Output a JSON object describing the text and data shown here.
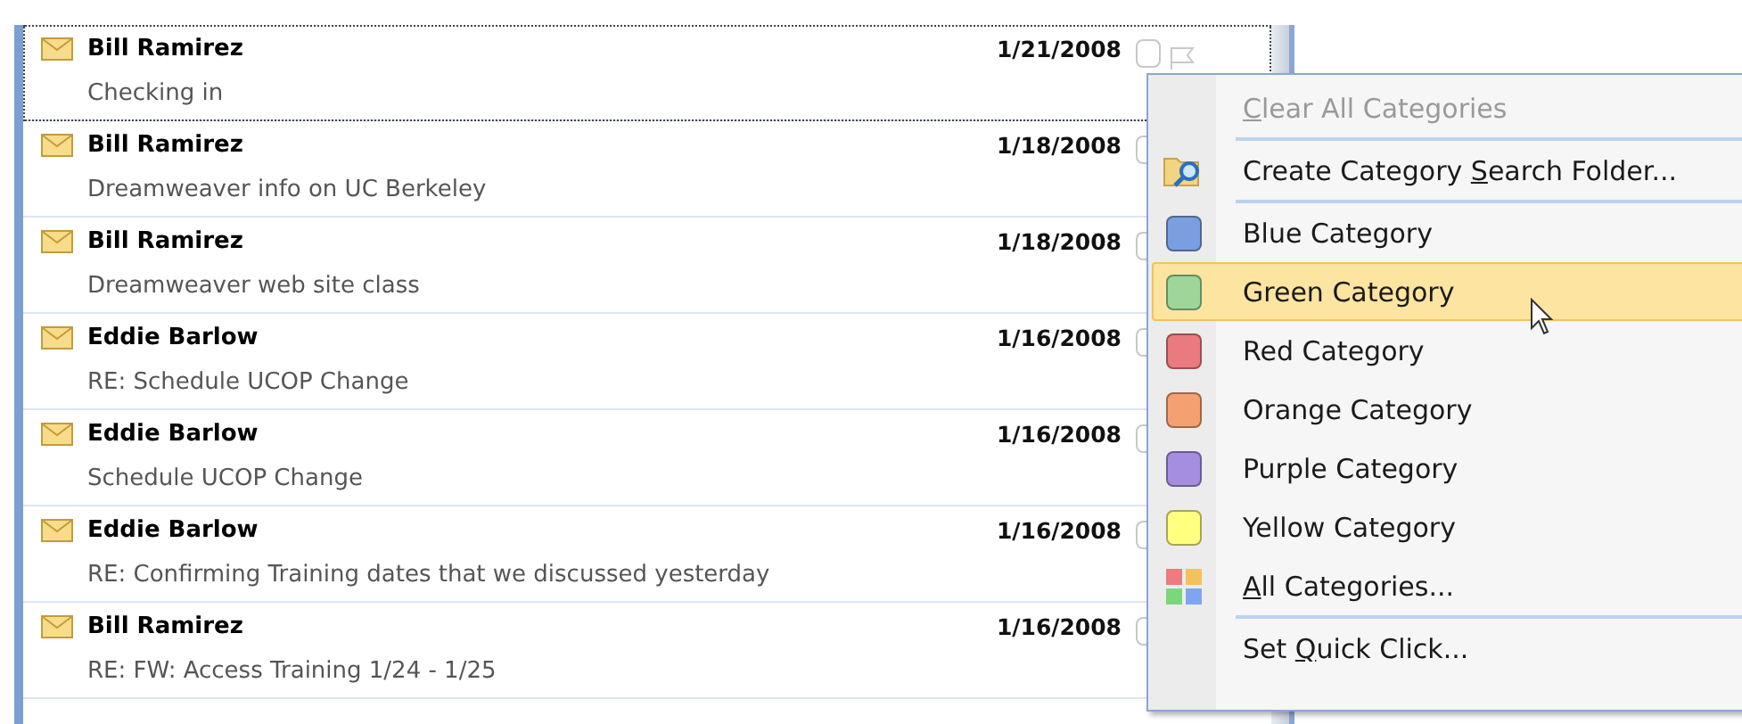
{
  "messages": [
    {
      "sender": "Bill Ramirez",
      "date": "1/21/2008",
      "subject": "Checking in",
      "focused": true
    },
    {
      "sender": "Bill Ramirez",
      "date": "1/18/2008",
      "subject": "Dreamweaver info on UC Berkeley",
      "focused": false
    },
    {
      "sender": "Bill Ramirez",
      "date": "1/18/2008",
      "subject": "Dreamweaver web site class",
      "focused": false
    },
    {
      "sender": "Eddie Barlow",
      "date": "1/16/2008",
      "subject": "RE: Schedule UCOP Change",
      "focused": false
    },
    {
      "sender": "Eddie Barlow",
      "date": "1/16/2008",
      "subject": "Schedule UCOP Change",
      "focused": false
    },
    {
      "sender": "Eddie Barlow",
      "date": "1/16/2008",
      "subject": "RE: Confirming Training dates that we discussed yesterday",
      "focused": false
    },
    {
      "sender": "Bill Ramirez",
      "date": "1/16/2008",
      "subject": "RE: FW: Access Training 1/24 - 1/25",
      "focused": false
    }
  ],
  "category_menu": {
    "items": [
      {
        "kind": "clear",
        "label": {
          "key": "C",
          "after": "lear All Categories"
        },
        "disabled": true,
        "selected": false,
        "divider_above": false
      },
      {
        "kind": "folder",
        "label": {
          "before": "Create Category ",
          "key": "S",
          "after": "earch Folder..."
        },
        "disabled": false,
        "selected": false,
        "divider_above": true
      },
      {
        "kind": "color",
        "color": "#7b9ee0",
        "label": {
          "before": "Blue Category"
        },
        "disabled": false,
        "selected": false,
        "divider_above": true
      },
      {
        "kind": "color",
        "color": "#9ed69a",
        "label": {
          "before": "Green Category"
        },
        "disabled": false,
        "selected": true,
        "divider_above": false
      },
      {
        "kind": "color",
        "color": "#ea7a80",
        "label": {
          "before": "Red Category"
        },
        "disabled": false,
        "selected": false,
        "divider_above": false
      },
      {
        "kind": "color",
        "color": "#f4a070",
        "label": {
          "before": "Orange Category"
        },
        "disabled": false,
        "selected": false,
        "divider_above": false
      },
      {
        "kind": "color",
        "color": "#a58ee0",
        "label": {
          "before": "Purple Category"
        },
        "disabled": false,
        "selected": false,
        "divider_above": false
      },
      {
        "kind": "color",
        "color": "#ffff80",
        "label": {
          "before": "Yellow Category"
        },
        "disabled": false,
        "selected": false,
        "divider_above": false
      },
      {
        "kind": "all",
        "label": {
          "key": "A",
          "after": "ll Categories..."
        },
        "disabled": false,
        "selected": false,
        "divider_above": false
      },
      {
        "kind": "quick",
        "label": {
          "before": "Set ",
          "key": "Q",
          "after": "uick Click..."
        },
        "disabled": false,
        "selected": false,
        "divider_above": true
      }
    ]
  }
}
